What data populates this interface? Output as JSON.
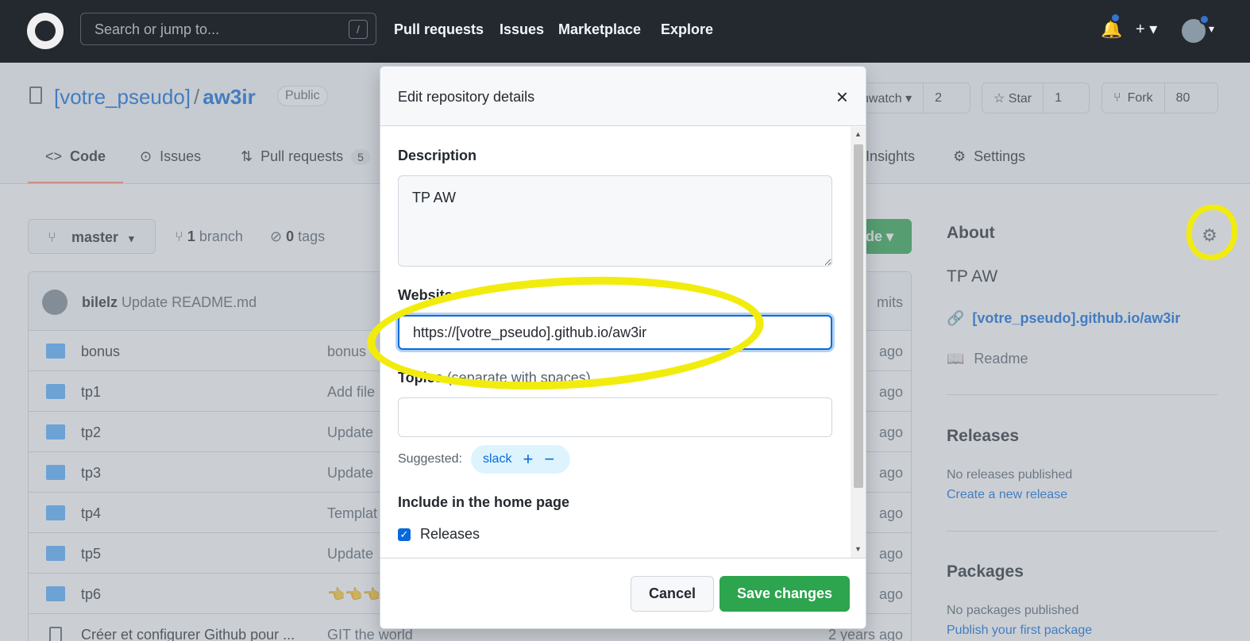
{
  "header": {
    "search_placeholder": "Search or jump to...",
    "search_shortcut": "/",
    "nav": [
      "Pull requests",
      "Issues",
      "Marketplace",
      "Explore"
    ],
    "plus_label": "+ ▾"
  },
  "repo": {
    "owner": "[votre_pseudo]",
    "separator": "/",
    "name": "aw3ir",
    "visibility": "Public",
    "watch_label": "nwatch ▾",
    "watch_count": "2",
    "star_label": "☆ Star",
    "star_count": "1",
    "fork_label": "Fork",
    "fork_count": "80"
  },
  "tabs": {
    "code": "Code",
    "issues": "Issues",
    "pulls": "Pull requests",
    "pulls_count": "5",
    "insights": "Insights",
    "settings": "Settings"
  },
  "main": {
    "branch": "master",
    "branch_count": "1",
    "branch_label": "branch",
    "tag_count": "0",
    "tag_label": "tags",
    "code_button": "de ▾",
    "commit_author": "bilelz",
    "commit_message": "Update README.md",
    "commits_suffix": "mits",
    "files": [
      {
        "name": "bonus",
        "message": "bonus",
        "ago": "ago",
        "type": "dir"
      },
      {
        "name": "tp1",
        "message": "Add file",
        "ago": "ago",
        "type": "dir"
      },
      {
        "name": "tp2",
        "message": "Update",
        "ago": "ago",
        "type": "dir"
      },
      {
        "name": "tp3",
        "message": "Update",
        "ago": "ago",
        "type": "dir"
      },
      {
        "name": "tp4",
        "message": "Templat",
        "ago": "ago",
        "type": "dir"
      },
      {
        "name": "tp5",
        "message": "Update",
        "ago": "ago",
        "type": "dir"
      },
      {
        "name": "tp6",
        "message": "👈👈👈",
        "ago": "ago",
        "type": "dir"
      },
      {
        "name": "Créer et configurer Github pour ...",
        "message": "GIT the world",
        "ago": "2 years ago",
        "type": "file"
      }
    ]
  },
  "sidebar": {
    "about_heading": "About",
    "description": "TP AW",
    "website": "[votre_pseudo].github.io/aw3ir",
    "readme": "Readme",
    "releases_heading": "Releases",
    "releases_none": "No releases published",
    "releases_link": "Create a new release",
    "packages_heading": "Packages",
    "packages_none": "No packages published",
    "packages_link": "Publish your first package"
  },
  "dialog": {
    "title": "Edit repository details",
    "close": "×",
    "description_label": "Description",
    "description_value": "TP AW",
    "website_label": "Website",
    "website_value": "https://[votre_pseudo].github.io/aw3ir",
    "topics_label": "Topics",
    "topics_note": "(separate with spaces)",
    "topics_value": "",
    "suggested_label": "Suggested:",
    "suggested_topic": "slack",
    "include_heading": "Include in the home page",
    "releases_option": "Releases",
    "cancel": "Cancel",
    "save": "Save changes"
  },
  "colors": {
    "header_bg": "#24292f",
    "accent_blue": "#0969da",
    "primary_green": "#2da44e",
    "highlight_yellow": "#f2ec0e"
  }
}
